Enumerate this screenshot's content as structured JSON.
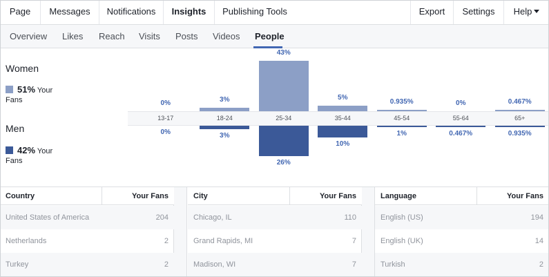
{
  "top_nav": {
    "items": [
      "Page",
      "Messages",
      "Notifications",
      "Insights",
      "Publishing Tools"
    ],
    "right_items": [
      "Export",
      "Settings",
      "Help"
    ],
    "active": "Insights"
  },
  "sub_nav": {
    "items": [
      "Overview",
      "Likes",
      "Reach",
      "Visits",
      "Posts",
      "Videos",
      "People"
    ],
    "active": "People"
  },
  "demographics": {
    "women": {
      "label": "Women",
      "percent": "51%",
      "suffix": "Your",
      "suffix2": "Fans",
      "color": "#8c9fc6"
    },
    "men": {
      "label": "Men",
      "percent": "42%",
      "suffix": "Your",
      "suffix2": "Fans",
      "color": "#3b5998"
    }
  },
  "chart_data": {
    "type": "bar",
    "categories": [
      "13-17",
      "18-24",
      "25-34",
      "35-44",
      "45-54",
      "55-64",
      "65+"
    ],
    "series": [
      {
        "name": "Women",
        "values": [
          0,
          3,
          43,
          5,
          0.935,
          0,
          0.467
        ],
        "labels": [
          "0%",
          "3%",
          "43%",
          "5%",
          "0.935%",
          "0%",
          "0.467%"
        ],
        "color": "#8c9fc6"
      },
      {
        "name": "Men",
        "values": [
          0,
          3,
          26,
          10,
          1,
          0.467,
          0.935
        ],
        "labels": [
          "0%",
          "3%",
          "26%",
          "10%",
          "1%",
          "0.467%",
          "0.935%"
        ],
        "color": "#3b5998"
      }
    ],
    "ylim": [
      0,
      43
    ]
  },
  "tables": [
    {
      "header": "Country",
      "value_header": "Your Fans",
      "rows": [
        {
          "name": "United States of America",
          "value": "204"
        },
        {
          "name": "Netherlands",
          "value": "2"
        },
        {
          "name": "Turkey",
          "value": "2"
        }
      ]
    },
    {
      "header": "City",
      "value_header": "Your Fans",
      "rows": [
        {
          "name": "Chicago, IL",
          "value": "110"
        },
        {
          "name": "Grand Rapids, MI",
          "value": "7"
        },
        {
          "name": "Madison, WI",
          "value": "7"
        }
      ]
    },
    {
      "header": "Language",
      "value_header": "Your Fans",
      "rows": [
        {
          "name": "English (US)",
          "value": "194"
        },
        {
          "name": "English (UK)",
          "value": "14"
        },
        {
          "name": "Turkish",
          "value": "2"
        }
      ]
    }
  ]
}
